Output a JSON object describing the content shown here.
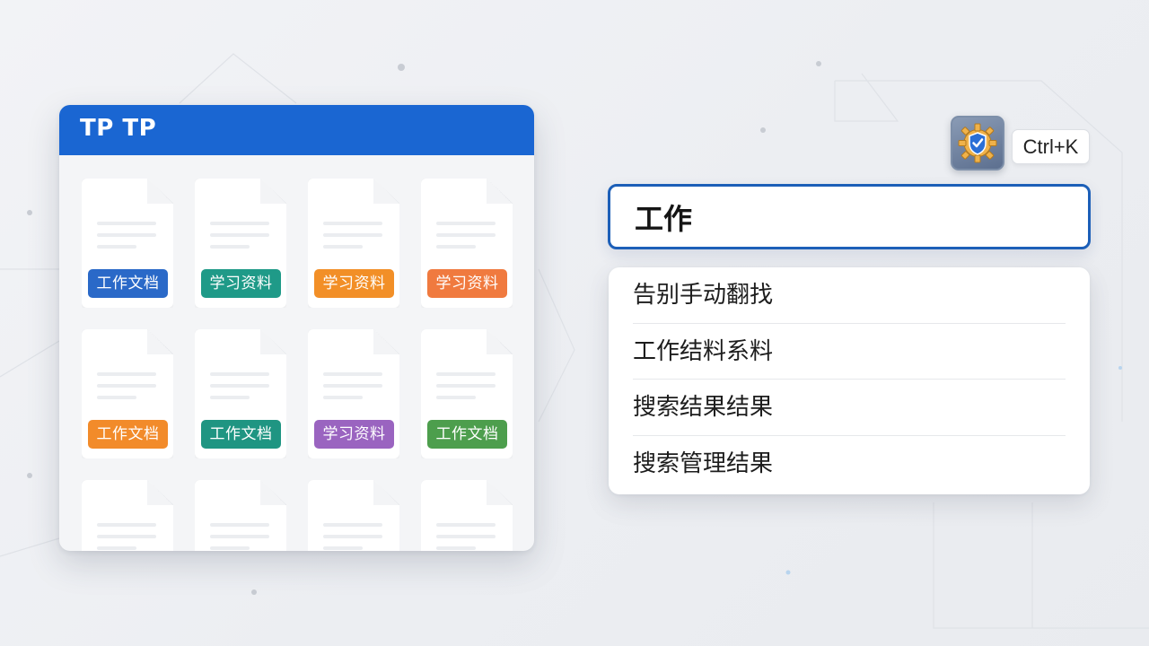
{
  "window": {
    "title": "TP TP"
  },
  "files": [
    {
      "tag": "工作文档",
      "color": "#2a69c8"
    },
    {
      "tag": "学习资料",
      "color": "#1f9a88"
    },
    {
      "tag": "学习资料",
      "color": "#f28f27"
    },
    {
      "tag": "学习资料",
      "color": "#f07a3f"
    },
    {
      "tag": "工作文档",
      "color": "#f28b2a"
    },
    {
      "tag": "工作文档",
      "color": "#1f9582"
    },
    {
      "tag": "学习资料",
      "color": "#9a64c0"
    },
    {
      "tag": "工作文档",
      "color": "#4d9e4d"
    },
    {
      "tag": "",
      "color": ""
    },
    {
      "tag": "",
      "color": ""
    },
    {
      "tag": "",
      "color": ""
    },
    {
      "tag": "",
      "color": ""
    }
  ],
  "launcher": {
    "icon": "gear-shield-icon",
    "shortcut": "Ctrl+K"
  },
  "search": {
    "value": "工作"
  },
  "results": [
    "告别手动翻找",
    "工作结料系料",
    "搜索结果结果",
    "搜索管理结果"
  ],
  "colors": {
    "accent": "#1a66d2",
    "search_border": "#1c5fb8"
  }
}
